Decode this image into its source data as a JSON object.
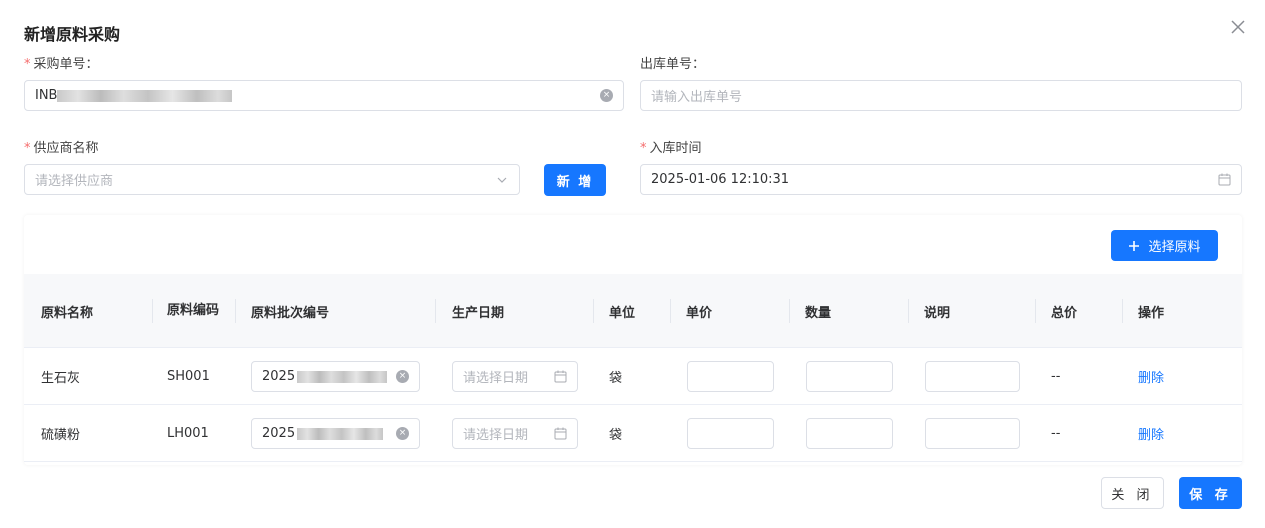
{
  "dialog": {
    "title": "新增原料采购"
  },
  "form": {
    "purchase_no": {
      "label": "采购单号：",
      "value": "INB"
    },
    "outbound_no": {
      "label": "出库单号：",
      "placeholder": "请输入出库单号"
    },
    "supplier": {
      "label": "供应商名称",
      "placeholder": "请选择供应商",
      "add_label": "新 增"
    },
    "inbound_time": {
      "label": "入库时间",
      "value": "2025-01-06 12:10:31"
    },
    "required_mark": "*"
  },
  "materials": {
    "select_label": "选择原料",
    "columns": [
      "原料名称",
      "原料编码",
      "原料批次编号",
      "生产日期",
      "单位",
      "单价",
      "数量",
      "说明",
      "总价",
      "操作"
    ],
    "rows": [
      {
        "name": "生石灰",
        "code": "SH001",
        "batch": "2025",
        "date_placeholder": "请选择日期",
        "unit": "袋",
        "total": "--",
        "action": "删除"
      },
      {
        "name": "硫磺粉",
        "code": "LH001",
        "batch": "2025",
        "date_placeholder": "请选择日期",
        "unit": "袋",
        "total": "--",
        "action": "删除"
      }
    ]
  },
  "footer": {
    "close_label": "关 闭",
    "save_label": "保 存"
  },
  "colors": {
    "primary": "#1677ff",
    "required": "#f56c6c",
    "placeholder": "#b3b6bc"
  },
  "icons": [
    "close-icon",
    "clear-icon",
    "chevron-down-icon",
    "calendar-icon",
    "plus-icon"
  ]
}
